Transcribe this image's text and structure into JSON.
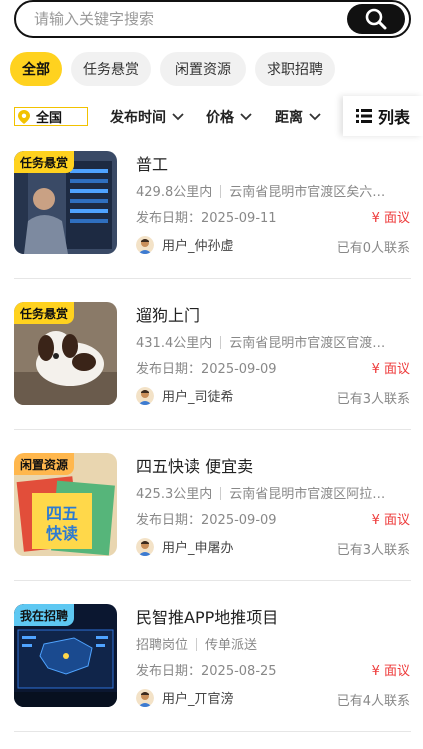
{
  "search": {
    "placeholder": "请输入关键字搜索"
  },
  "categories": [
    {
      "label": "全部"
    },
    {
      "label": "任务悬赏"
    },
    {
      "label": "闲置资源"
    },
    {
      "label": "求职招聘"
    }
  ],
  "filters": {
    "location": "全国",
    "publish_time": "发布时间",
    "price": "价格",
    "distance": "距离",
    "view_mode": "列表"
  },
  "listings": [
    {
      "tag": "任务悬赏",
      "tag_color": "#ffd21f",
      "title": "普工",
      "distance": "429.8公里内",
      "address": "云南省昆明市官渡区矣六…",
      "date": "发布日期：2025-09-11",
      "price": "¥ 面议",
      "user": "用户_仲孙虚",
      "contacts": "已有0人联系"
    },
    {
      "tag": "任务悬赏",
      "tag_color": "#ffd21f",
      "title": "遛狗上门",
      "distance": "431.4公里内",
      "address": "云南省昆明市官渡区官渡…",
      "date": "发布日期：2025-09-09",
      "price": "¥ 面议",
      "user": "用户_司徒希",
      "contacts": "已有3人联系"
    },
    {
      "tag": "闲置资源",
      "tag_color": "#ffb74d",
      "title": "四五快读 便宜卖",
      "distance": "425.3公里内",
      "address": "云南省昆明市官渡区阿拉…",
      "date": "发布日期：2025-09-09",
      "price": "¥ 面议",
      "user": "用户_申屠办",
      "contacts": "已有3人联系"
    },
    {
      "tag": "我在招聘",
      "tag_color": "#5ec8f2",
      "title": "民智推APP地推项目",
      "distance": "招聘岗位",
      "address": "传单派送",
      "date": "发布日期：2025-08-25",
      "price": "¥ 面议",
      "user": "用户_丌官滂",
      "contacts": "已有4人联系"
    }
  ]
}
